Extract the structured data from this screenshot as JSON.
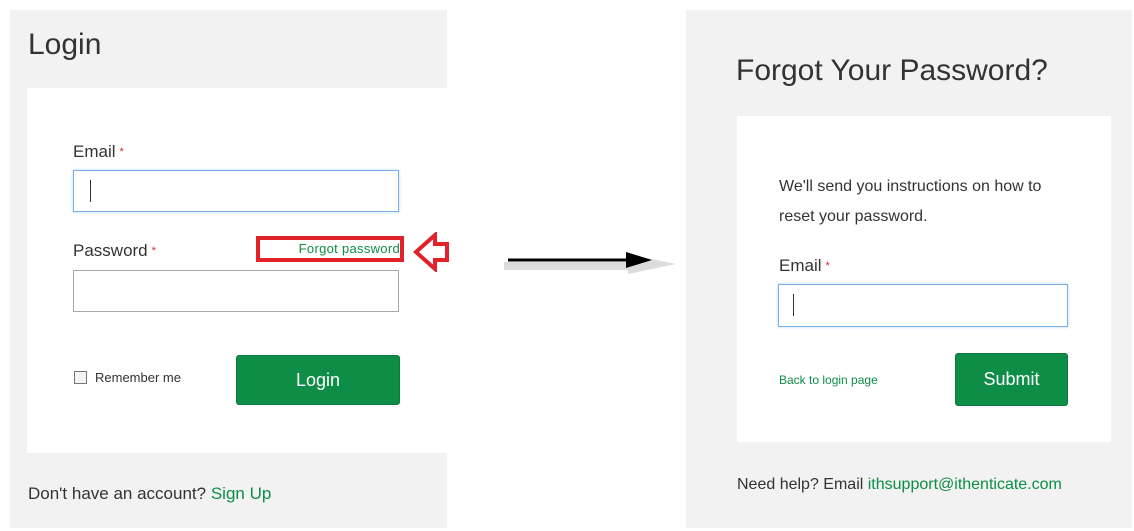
{
  "login": {
    "title": "Login",
    "email_label": "Email",
    "required_mark": "*",
    "email_value": "",
    "password_label": "Password",
    "password_value": "",
    "forgot_link": "Forgot password",
    "remember_label": "Remember me",
    "remember_checked": false,
    "login_button": "Login",
    "footer_text": "Don't have an account?",
    "signup_link": "Sign Up"
  },
  "forgot": {
    "title": "Forgot Your Password?",
    "instructions": "We'll send you instructions on how to reset your password.",
    "email_label": "Email",
    "required_mark": "*",
    "email_value": "",
    "back_link": "Back to login page",
    "submit_button": "Submit",
    "help_text": "Need help? Email",
    "help_email": "ithsupport@ithenticate.com"
  },
  "colors": {
    "accent_green": "#0d8d46",
    "highlight_red": "#e2222b",
    "panel_bg": "#f2f2f2"
  }
}
